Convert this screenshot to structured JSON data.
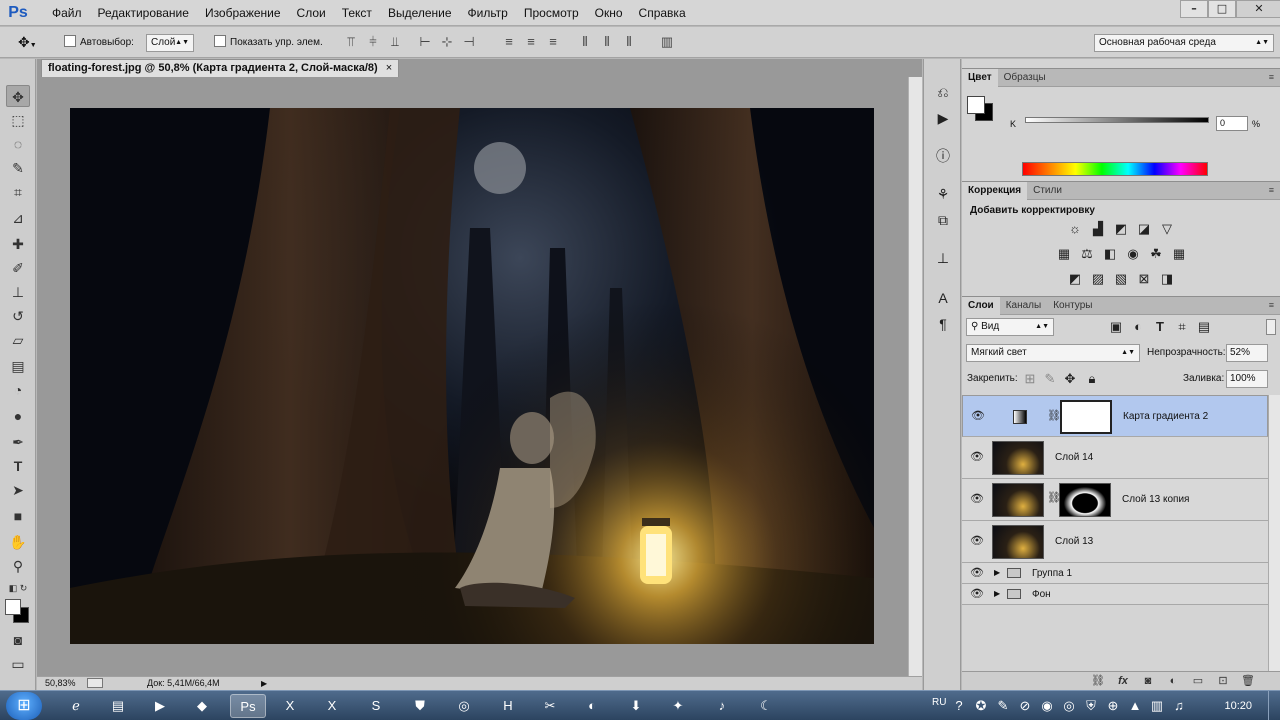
{
  "app": {
    "logo": "Ps"
  },
  "menu": [
    "Файл",
    "Редактирование",
    "Изображение",
    "Слои",
    "Текст",
    "Выделение",
    "Фильтр",
    "Просмотр",
    "Окно",
    "Справка"
  ],
  "window_buttons": {
    "minimize": "–",
    "maximize": "□",
    "close": "✕"
  },
  "options_bar": {
    "tool_icon": "move-tool-icon",
    "autoselect_label": "Автовыбор:",
    "autoselect_value": "Слой",
    "show_controls_label": "Показать упр. элем.",
    "workspace": "Основная рабочая среда"
  },
  "tools": [
    {
      "name": "move-tool",
      "glyph": "✥"
    },
    {
      "name": "marquee-tool",
      "glyph": "⬚"
    },
    {
      "name": "lasso-tool",
      "glyph": "◌"
    },
    {
      "name": "quick-selection-tool",
      "glyph": "✎"
    },
    {
      "name": "crop-tool",
      "glyph": "⌗"
    },
    {
      "name": "eyedropper-tool",
      "glyph": "⊿"
    },
    {
      "name": "healing-brush-tool",
      "glyph": "✚"
    },
    {
      "name": "brush-tool",
      "glyph": "✐"
    },
    {
      "name": "clone-stamp-tool",
      "glyph": "⊥"
    },
    {
      "name": "history-brush-tool",
      "glyph": "↺"
    },
    {
      "name": "eraser-tool",
      "glyph": "▱"
    },
    {
      "name": "gradient-tool",
      "glyph": "▤"
    },
    {
      "name": "blur-tool",
      "glyph": "◔"
    },
    {
      "name": "dodge-tool",
      "glyph": "●"
    },
    {
      "name": "pen-tool",
      "glyph": "✒"
    },
    {
      "name": "type-tool",
      "glyph": "T"
    },
    {
      "name": "path-selection-tool",
      "glyph": "➤"
    },
    {
      "name": "shape-tool",
      "glyph": "■"
    },
    {
      "name": "hand-tool",
      "glyph": "✋"
    },
    {
      "name": "zoom-tool",
      "glyph": "⚲"
    }
  ],
  "document": {
    "tab_title": "floating-forest.jpg @ 50,8% (Карта градиента 2, Слой-маска/8)",
    "tab_close": "×",
    "zoom": "50,83%",
    "doc_info": "Док: 5,41M/66,4M"
  },
  "color_panel": {
    "tabs": [
      "Цвет",
      "Образцы"
    ],
    "channel_label": "K",
    "channel_value": "0",
    "unit": "%"
  },
  "adjustments_panel": {
    "tabs": [
      "Коррекция",
      "Стили"
    ],
    "heading": "Добавить корректировку"
  },
  "layers_panel": {
    "tabs": [
      "Слои",
      "Каналы",
      "Контуры"
    ],
    "filter": "Вид",
    "blend_mode": "Мягкий свет",
    "opacity_label": "Непрозрачность:",
    "opacity_value": "52%",
    "lock_label": "Закрепить:",
    "fill_label": "Заливка:",
    "fill_value": "100%",
    "layers": [
      {
        "name": "Карта градиента 2",
        "selected": true
      },
      {
        "name": "Слой 14",
        "selected": false
      },
      {
        "name": "Слой 13 копия",
        "selected": false
      },
      {
        "name": "Слой 13",
        "selected": false
      },
      {
        "name": "Группа 1",
        "selected": false
      },
      {
        "name": "Фон",
        "selected": false
      }
    ]
  },
  "taskbar": {
    "language": "RU",
    "clock": "10:20"
  },
  "colors": {
    "selected_layer": "#b2c8ee",
    "ps_blue": "#1e5bbf"
  }
}
